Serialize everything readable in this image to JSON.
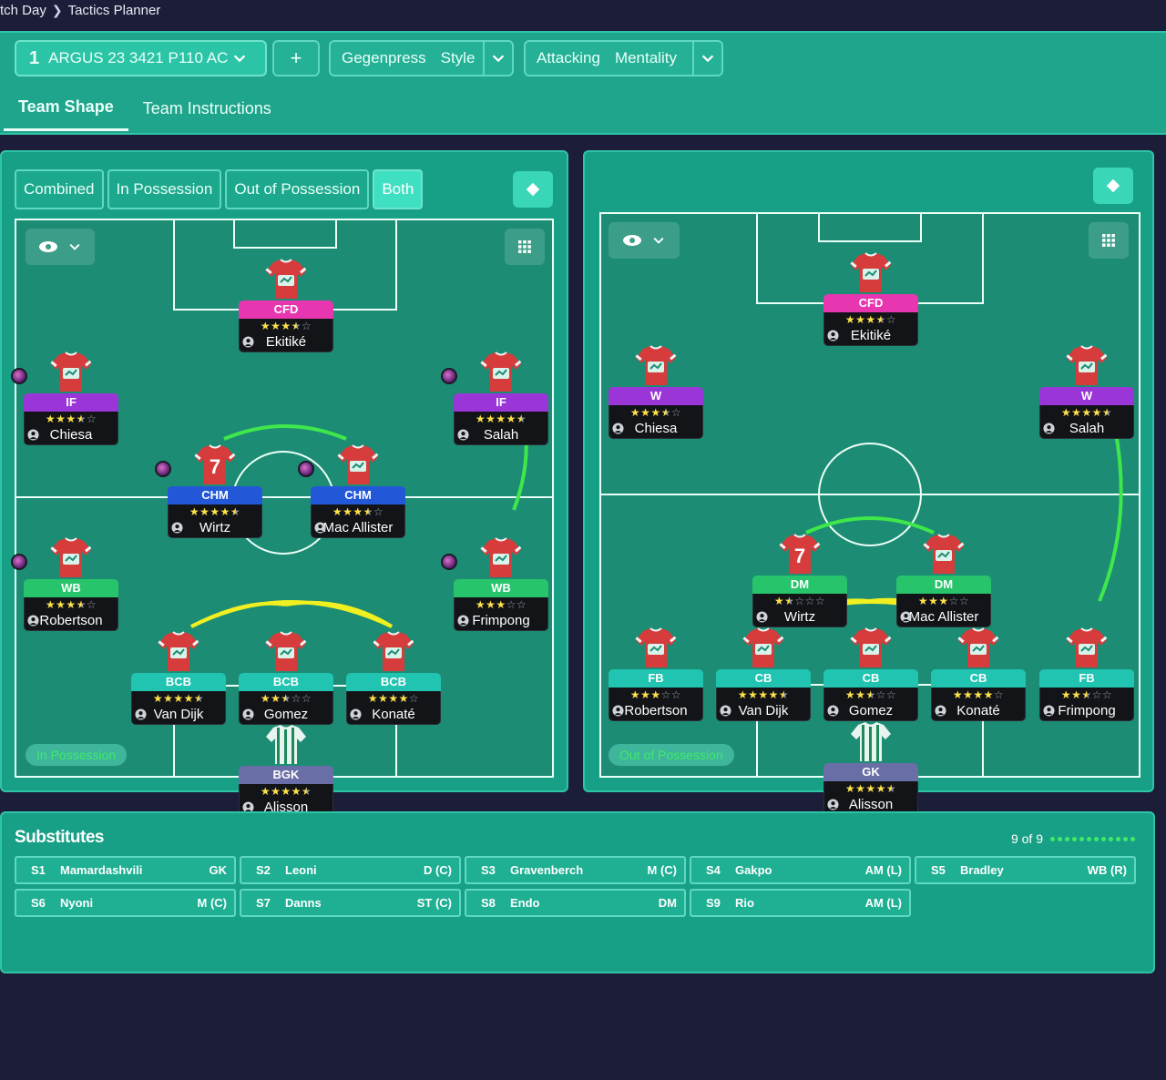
{
  "breadcrumb": {
    "parent": "tch Day",
    "current": "Tactics Planner"
  },
  "toolbar": {
    "tactic_num": "1",
    "tactic_name": "ARGUS 23 3421 P110 AC",
    "add_label": "+",
    "style_a": "Gegenpress",
    "style_b": "Style",
    "mentality_a": "Attacking",
    "mentality_b": "Mentality"
  },
  "tabs": {
    "team_shape": "Team Shape",
    "team_instructions": "Team Instructions"
  },
  "filters": {
    "combined": "Combined",
    "in_possession": "In Possession",
    "out_of_possession": "Out of Possession",
    "both": "Both"
  },
  "left_pitch": {
    "label": "In Possession",
    "players": [
      {
        "role": "CFD",
        "name": "Ekitiké",
        "stars": 3.5,
        "color": "pink",
        "shirt": "red"
      },
      {
        "role": "IF",
        "name": "Chiesa",
        "stars": 3.5,
        "color": "purple",
        "shirt": "red",
        "orb": true
      },
      {
        "role": "IF",
        "name": "Salah",
        "stars": 4.5,
        "color": "purple",
        "shirt": "red",
        "orb": true
      },
      {
        "role": "CHM",
        "name": "Wirtz",
        "stars": 4.5,
        "color": "blue",
        "shirt": "red7",
        "orb": true
      },
      {
        "role": "CHM",
        "name": "Mac Allister",
        "stars": 3.5,
        "color": "blue",
        "shirt": "red",
        "orb": true
      },
      {
        "role": "WB",
        "name": "Robertson",
        "stars": 3.5,
        "color": "green",
        "shirt": "red",
        "orb": true
      },
      {
        "role": "WB",
        "name": "Frimpong",
        "stars": 3,
        "color": "green",
        "shirt": "red",
        "orb": true
      },
      {
        "role": "BCB",
        "name": "Van Dijk",
        "stars": 4.5,
        "color": "teal",
        "shirt": "red"
      },
      {
        "role": "BCB",
        "name": "Gomez",
        "stars": 2.5,
        "color": "teal",
        "shirt": "red"
      },
      {
        "role": "BCB",
        "name": "Konaté",
        "stars": 4,
        "color": "teal",
        "shirt": "red"
      },
      {
        "role": "BGK",
        "name": "Alisson",
        "stars": 4.5,
        "color": "slate",
        "shirt": "gk"
      }
    ]
  },
  "right_pitch": {
    "label": "Out of Possession",
    "players": [
      {
        "role": "CFD",
        "name": "Ekitiké",
        "stars": 3.5,
        "color": "pink",
        "shirt": "red"
      },
      {
        "role": "W",
        "name": "Chiesa",
        "stars": 3.5,
        "color": "purple",
        "shirt": "red"
      },
      {
        "role": "W",
        "name": "Salah",
        "stars": 4.5,
        "color": "purple",
        "shirt": "red"
      },
      {
        "role": "DM",
        "name": "Wirtz",
        "stars": 1.5,
        "color": "green",
        "shirt": "red7"
      },
      {
        "role": "DM",
        "name": "Mac Allister",
        "stars": 3,
        "color": "green",
        "shirt": "red"
      },
      {
        "role": "FB",
        "name": "Robertson",
        "stars": 3,
        "color": "teal",
        "shirt": "red"
      },
      {
        "role": "CB",
        "name": "Van Dijk",
        "stars": 4.5,
        "color": "teal",
        "shirt": "red"
      },
      {
        "role": "CB",
        "name": "Gomez",
        "stars": 2.5,
        "color": "teal",
        "shirt": "red"
      },
      {
        "role": "CB",
        "name": "Konaté",
        "stars": 4,
        "color": "teal",
        "shirt": "red"
      },
      {
        "role": "FB",
        "name": "Frimpong",
        "stars": 2.5,
        "color": "teal",
        "shirt": "red"
      },
      {
        "role": "GK",
        "name": "Alisson",
        "stars": 4.5,
        "color": "slate",
        "shirt": "gk"
      }
    ]
  },
  "substitutes": {
    "title": "Substitutes",
    "count": "9 of 9",
    "items": [
      {
        "slot": "S1",
        "name": "Mamardashvili",
        "pos": "GK"
      },
      {
        "slot": "S2",
        "name": "Leoni",
        "pos": "D (C)"
      },
      {
        "slot": "S3",
        "name": "Gravenberch",
        "pos": "M (C)"
      },
      {
        "slot": "S4",
        "name": "Gakpo",
        "pos": "AM (L)"
      },
      {
        "slot": "S5",
        "name": "Bradley",
        "pos": "WB (R)"
      },
      {
        "slot": "S6",
        "name": "Nyoni",
        "pos": "M (C)"
      },
      {
        "slot": "S7",
        "name": "Danns",
        "pos": "ST (C)"
      },
      {
        "slot": "S8",
        "name": "Endo",
        "pos": "DM"
      },
      {
        "slot": "S9",
        "name": "Rio",
        "pos": "AM (L)"
      }
    ]
  },
  "icons": [
    "chevron-down-icon",
    "plus-icon",
    "diamond-icon",
    "eye-icon",
    "grid-icon",
    "person-icon",
    "shirt-icon"
  ]
}
